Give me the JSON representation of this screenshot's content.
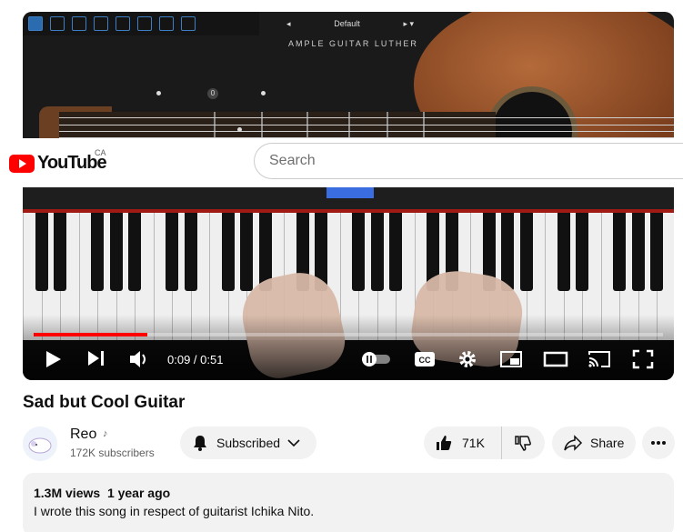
{
  "plugin": {
    "preset": "Default",
    "brand": "AMPLE GUITAR LUTHER",
    "fret_marker": "0"
  },
  "header": {
    "logo_text": "YouTube",
    "region": "CA",
    "search_placeholder": "Search"
  },
  "player": {
    "current_time": "0:09",
    "duration": "0:51",
    "time_display": "0:09 / 0:51",
    "progress_fraction": 0.18
  },
  "video": {
    "title": "Sad but Cool Guitar",
    "channel": "Reo",
    "subscribers": "172K subscribers",
    "subscribe_label": "Subscribed",
    "likes": "71K",
    "share_label": "Share",
    "views": "1.3M views",
    "age": "1 year ago",
    "description": "I wrote this song in respect of guitarist Ichika Nito."
  },
  "colors": {
    "brand_red": "#ff0000",
    "pill_bg": "#f2f2f2"
  }
}
